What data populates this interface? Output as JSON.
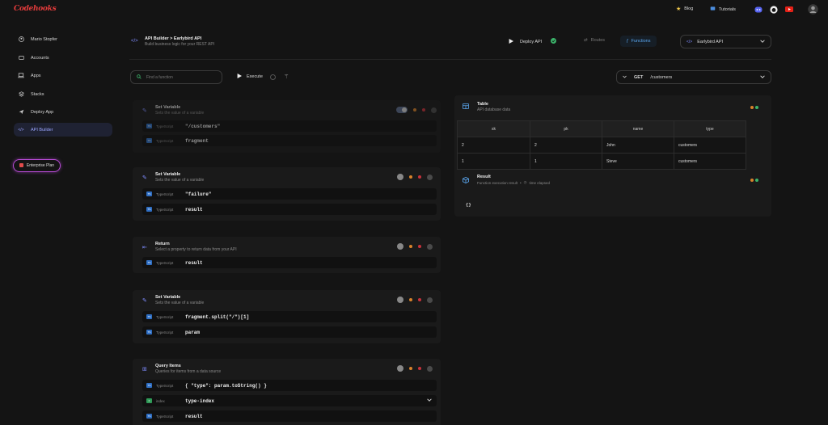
{
  "brand": {
    "name": "Codehooks"
  },
  "topnav": {
    "blog": "Blog",
    "tutorials": "Tutorials"
  },
  "sidebar": {
    "items": [
      {
        "label": "Mario Stopfer"
      },
      {
        "label": "Accounts"
      },
      {
        "label": "Apps"
      },
      {
        "label": "Stacks"
      },
      {
        "label": "Deploy App"
      },
      {
        "label": "API Builder"
      }
    ],
    "enterprise": "Enterprise Plan"
  },
  "header": {
    "title": "API Builder > Earlybird API",
    "subtitle": "Build business logic for your REST API",
    "deploy": "Deploy API",
    "routes": "Routes",
    "functions": "Functions",
    "api_selected": "Earlybird API"
  },
  "toolbar": {
    "search_placeholder": "Find a function",
    "execute": "Execute",
    "method": "GET",
    "path": "/customers"
  },
  "steps": [
    {
      "title": "Set Variable",
      "desc": "Sets the value of a variable",
      "rows": [
        {
          "lang": "TypeScript",
          "code": "\"/customers\""
        },
        {
          "lang": "TypeScript",
          "code": "fragment"
        }
      ]
    },
    {
      "title": "Set Variable",
      "desc": "Sets the value of a variable",
      "rows": [
        {
          "lang": "TypeScript",
          "code": "\"failure\""
        },
        {
          "lang": "TypeScript",
          "code": "result"
        }
      ]
    },
    {
      "title": "Return",
      "desc": "Select a property to return data from your API",
      "rows": [
        {
          "lang": "TypeScript",
          "code": "result"
        }
      ]
    },
    {
      "title": "Set Variable",
      "desc": "Sets the value of a variable",
      "rows": [
        {
          "lang": "TypeScript",
          "code": "fragment.split(\"/\")[1]"
        },
        {
          "lang": "TypeScript",
          "code": "param"
        }
      ]
    },
    {
      "title": "Query Items",
      "desc": "Queries for items from a data source",
      "rows": [
        {
          "lang": "TypeScript",
          "code": "{ \"type\": param.toString() }"
        },
        {
          "lang": "index",
          "code": "type-index"
        },
        {
          "lang": "TypeScript",
          "code": "result"
        }
      ]
    }
  ],
  "table_panel": {
    "title": "Table",
    "subtitle": "API database data",
    "columns": [
      "sk",
      "pk",
      "name",
      "type"
    ],
    "rows": [
      [
        "2",
        "2",
        "John",
        "customers"
      ],
      [
        "1",
        "1",
        "Steve",
        "customers"
      ]
    ]
  },
  "result_panel": {
    "title": "Result",
    "subtitle": "Function execution result",
    "time": "time elapsed",
    "output": "{}"
  },
  "colors": {
    "accent": "#7f8cff",
    "active_bg": "#1f2233",
    "orange": "#d9822b",
    "red": "#c8323c",
    "green": "#3bb36a"
  }
}
